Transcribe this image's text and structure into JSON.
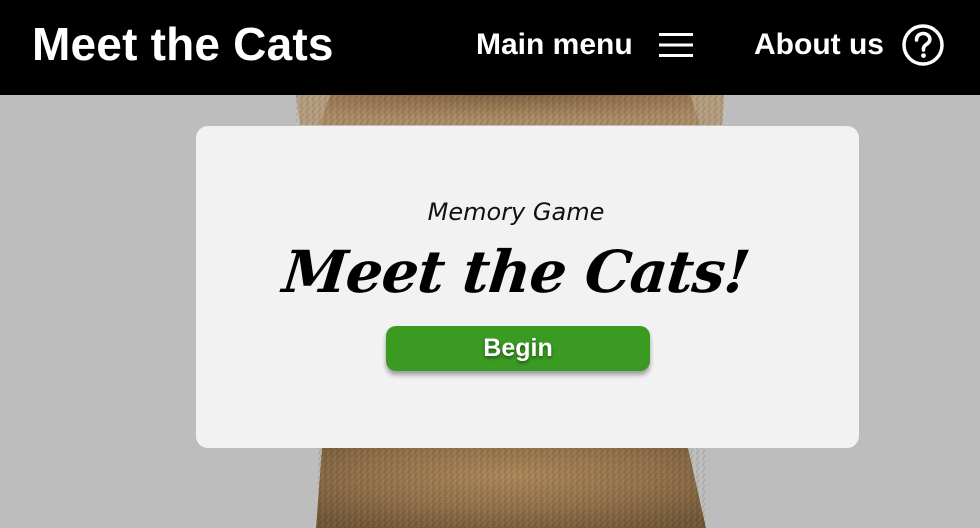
{
  "header": {
    "brand": "Meet the Cats",
    "main_menu_label": "Main menu",
    "main_menu_icon": "hamburger-menu-icon",
    "about_label": "About us",
    "about_icon": "question-circle-icon"
  },
  "card": {
    "subtitle": "Memory Game",
    "title": "Meet the Cats!",
    "begin_label": "Begin"
  },
  "colors": {
    "header_bg": "#000000",
    "page_bg": "#bdbdbd",
    "card_bg": "#f2f2f2",
    "button_bg": "#3a9a22",
    "cat_fur": "#9a7a55"
  }
}
